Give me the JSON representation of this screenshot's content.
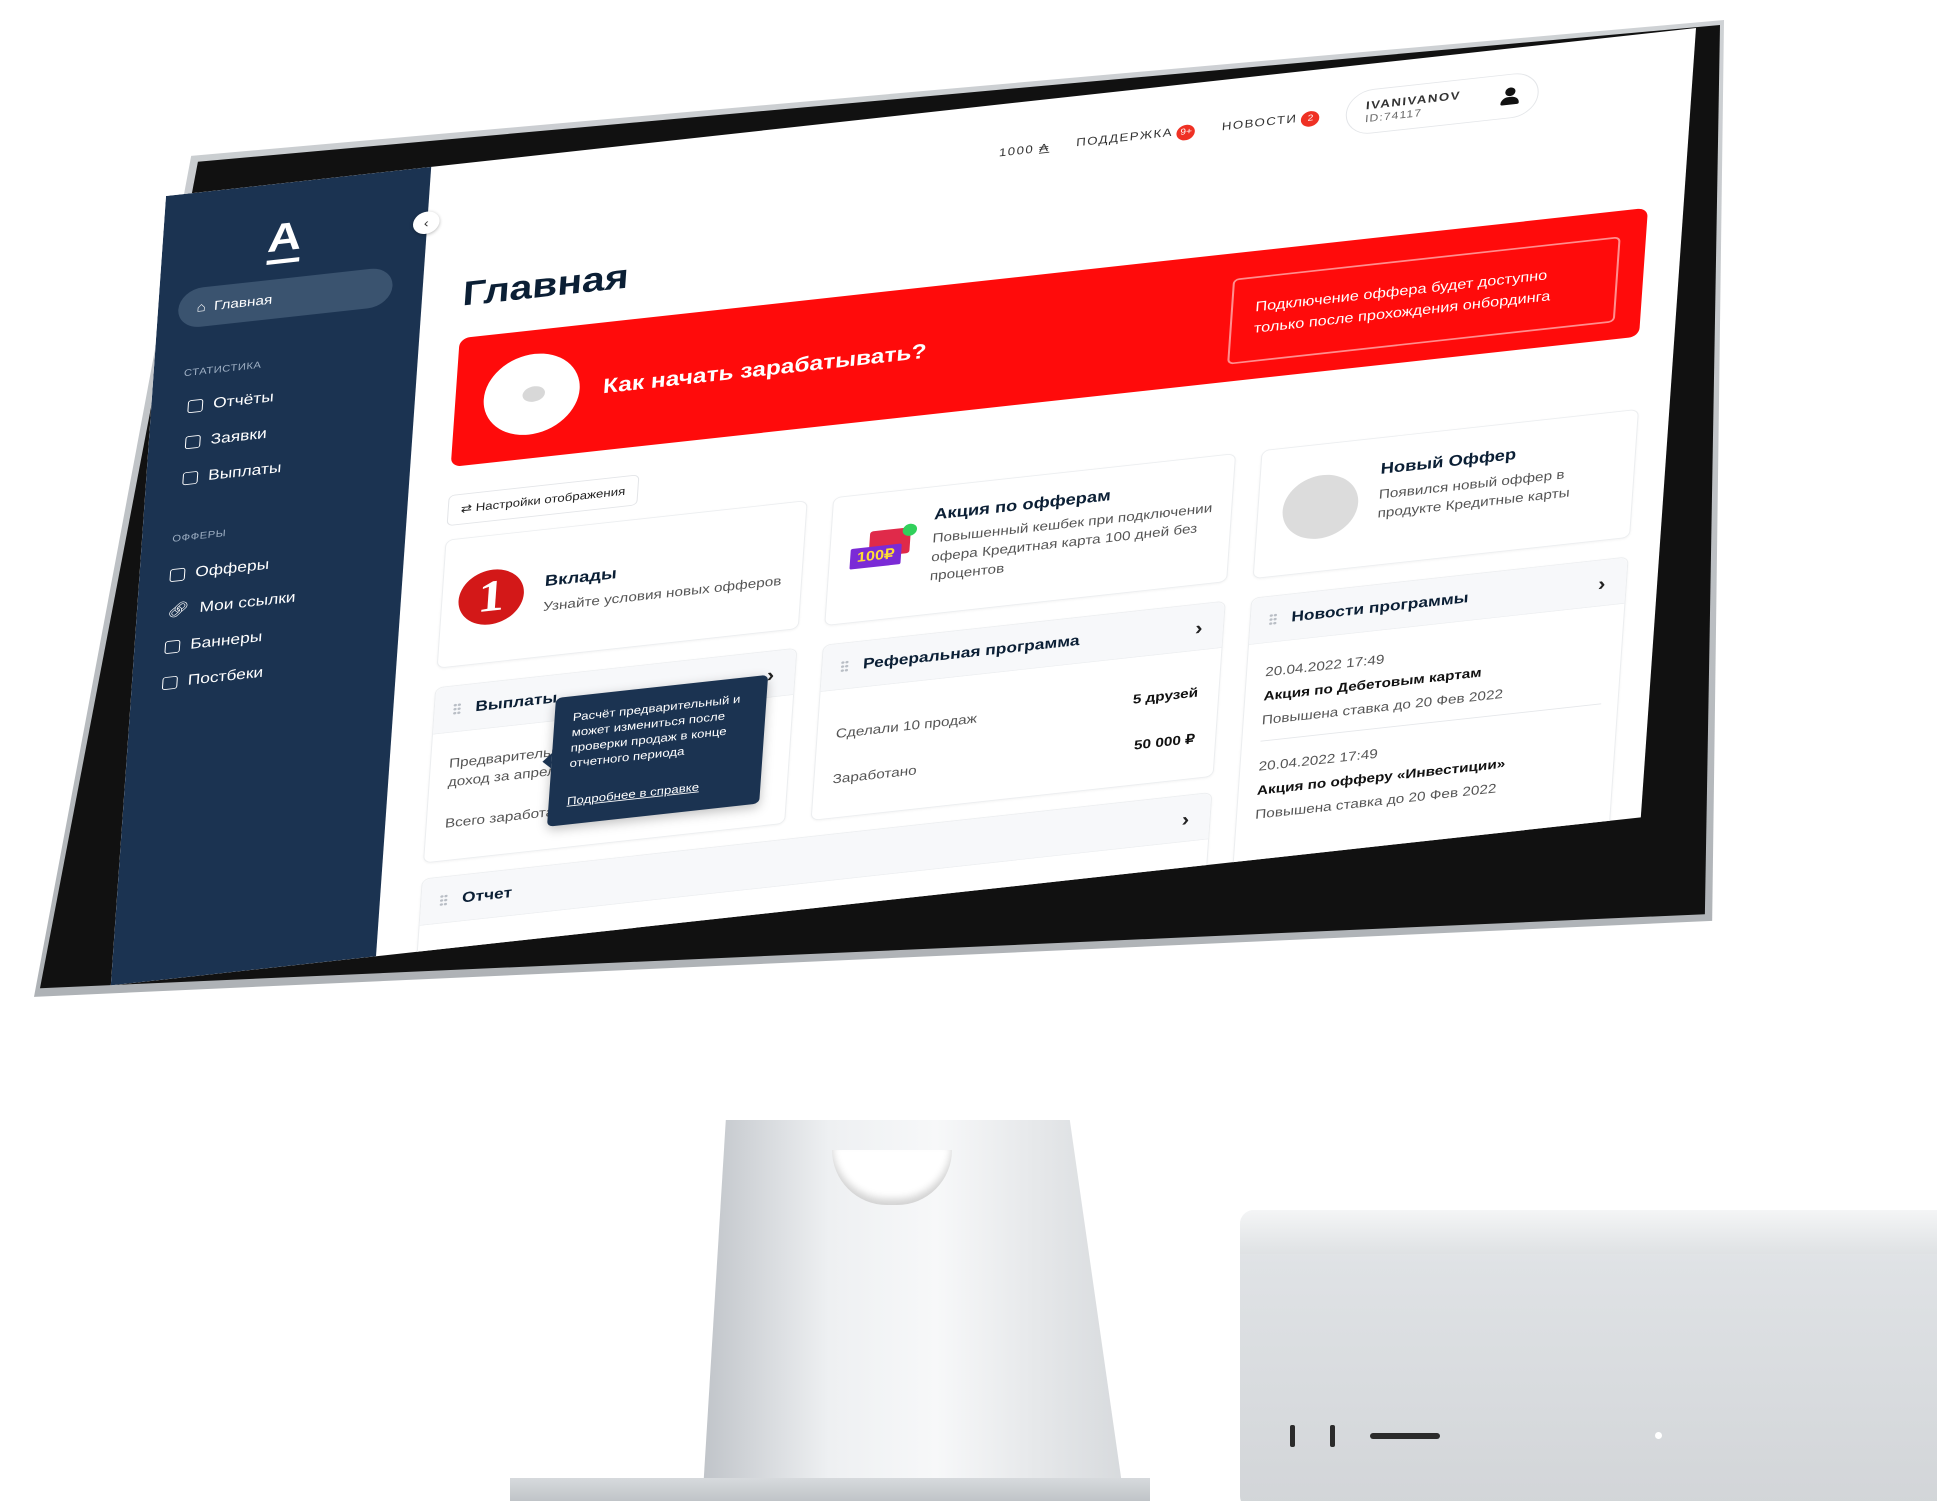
{
  "app": {
    "logo": "A"
  },
  "sidebar": {
    "home_label": "Главная",
    "sections": [
      {
        "title": "СТАТИСТИКА",
        "items": [
          "Отчёты",
          "Заявки",
          "Выплаты"
        ]
      },
      {
        "title": "ОФФЕРЫ",
        "items": [
          "Офферы",
          "Мои ссылки",
          "Баннеры",
          "Постбеки"
        ]
      }
    ]
  },
  "topbar": {
    "balance": "1000",
    "balance_unit": "₳",
    "support_label": "ПОДДЕРЖКА",
    "support_badge": "9+",
    "news_label": "НОВОСТИ",
    "news_badge": "2",
    "user_name": "IVANIVANOV",
    "user_id": "ID:74117"
  },
  "main": {
    "title": "Главная",
    "banner": {
      "title": "Как начать зарабатывать?",
      "note": "Подключение оффера будет доступно только после прохождения онбординга"
    },
    "settings_label": "Настройки отображения",
    "promos": [
      {
        "title": "Вклады",
        "text": "Узнайте условия новых офферов",
        "logo_text": "1"
      },
      {
        "title": "Акция по офферам",
        "text": "Повышенный кешбек при подключении офера Кредитная карта 100 дней без процентов",
        "image_text": "100₽"
      },
      {
        "title": "Новый Оффер",
        "text": "Появился новый оффер в продукте Кредитные карты"
      }
    ],
    "payouts": {
      "title": "Выплаты",
      "row1_label": "Предварительный доход за апрель",
      "row2_label": "Всего заработано",
      "tooltip_text": "Расчёт предварительный и может измениться после проверки продаж в конце отчетного периода",
      "tooltip_link": "Подробнее в справке"
    },
    "referral": {
      "title": "Реферальная программа",
      "row1_label": "Сделали 10 продаж",
      "row1_value": "5 друзей",
      "row2_label": "Заработано",
      "row2_value": "50 000 ₽"
    },
    "news": {
      "title": "Новости программы",
      "items": [
        {
          "date": "20.04.2022  17:49",
          "title": "Акция по Дебетовым картам",
          "text": "Повышена ставка до 20 Фев 2022"
        },
        {
          "date": "20.04.2022  17:49",
          "title": "Акция по офферу «Инвестиции»",
          "text": "Повышена ставка до 20 Фев 2022"
        }
      ]
    },
    "report": {
      "title": "Отчет"
    }
  },
  "colors": {
    "sidebar": "#1b3351",
    "accent": "#ff0b0b",
    "badge": "#ef3124"
  }
}
